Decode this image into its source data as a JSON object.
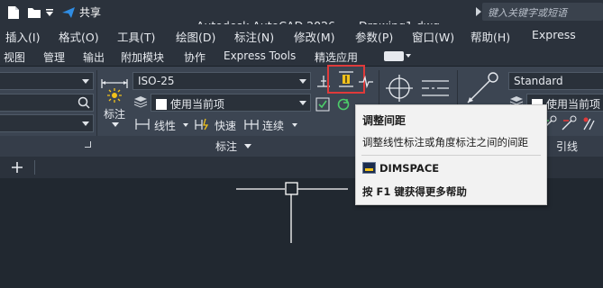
{
  "titlebar": {
    "share_label": "共享",
    "app_title": "Autodesk AutoCAD 2026",
    "doc_title": "Drawing1.dwg",
    "search_placeholder": "键入关键字或短语"
  },
  "menubar": {
    "items": [
      "插入(I)",
      "格式(O)",
      "工具(T)",
      "绘图(D)",
      "标注(N)",
      "修改(M)",
      "参数(P)",
      "窗口(W)",
      "帮助(H)",
      "Express"
    ]
  },
  "ribbon_tabs": {
    "items": [
      "视图",
      "管理",
      "输出",
      "附加模块",
      "协作",
      "Express Tools",
      "精选应用"
    ]
  },
  "ribbon": {
    "dim_style": "ISO-25",
    "use_current": "使用当前项",
    "dim_label": "标注",
    "linear": "线性",
    "quick": "快速",
    "continue": "连续",
    "panel_title": "标注",
    "mleader_style": "Standard",
    "mleader_current": "使用当前项",
    "leader_label": "引线"
  },
  "tooltip": {
    "title": "调整间距",
    "description": "调整线性标注或角度标注之间的间距",
    "command": "DIMSPACE",
    "help": "按 F1 键获得更多帮助"
  },
  "colors": {
    "background": "#212830",
    "ribbon": "#3c4552",
    "highlight_border": "#e03a3a",
    "tooltip_bg": "#f2f2f2"
  }
}
